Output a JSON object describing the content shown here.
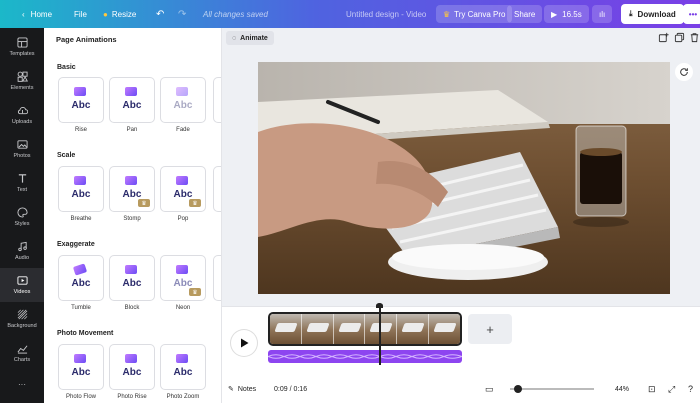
{
  "topbar": {
    "home": "Home",
    "file": "File",
    "resize": "Resize",
    "saved_status": "All changes saved",
    "doc_title": "Untitled design - Video",
    "try_pro": "Try Canva Pro",
    "share": "Share",
    "duration": "16.5s",
    "download": "Download",
    "more": "•••"
  },
  "rail": [
    {
      "label": "Templates",
      "icon": "templates-icon"
    },
    {
      "label": "Elements",
      "icon": "elements-icon"
    },
    {
      "label": "Uploads",
      "icon": "uploads-icon"
    },
    {
      "label": "Photos",
      "icon": "photos-icon"
    },
    {
      "label": "Text",
      "icon": "text-icon"
    },
    {
      "label": "Styles",
      "icon": "styles-icon"
    },
    {
      "label": "Audio",
      "icon": "audio-icon"
    },
    {
      "label": "Videos",
      "icon": "videos-icon"
    },
    {
      "label": "Background",
      "icon": "background-icon"
    },
    {
      "label": "Charts",
      "icon": "charts-icon"
    }
  ],
  "panel": {
    "title": "Page Animations",
    "tile_text": "Abc",
    "sections": [
      {
        "name": "Basic",
        "items": [
          {
            "label": "Rise",
            "pro": false
          },
          {
            "label": "Pan",
            "pro": false
          },
          {
            "label": "Fade",
            "pro": false
          }
        ]
      },
      {
        "name": "Scale",
        "items": [
          {
            "label": "Breathe",
            "pro": false
          },
          {
            "label": "Stomp",
            "pro": true
          },
          {
            "label": "Pop",
            "pro": true
          }
        ]
      },
      {
        "name": "Exaggerate",
        "items": [
          {
            "label": "Tumble",
            "pro": false
          },
          {
            "label": "Block",
            "pro": false
          },
          {
            "label": "Neon",
            "pro": true
          }
        ]
      },
      {
        "name": "Photo Movement",
        "items": [
          {
            "label": "Photo Flow",
            "pro": false
          },
          {
            "label": "Photo Rise",
            "pro": false
          },
          {
            "label": "Photo Zoom",
            "pro": false
          }
        ]
      }
    ]
  },
  "canvas": {
    "animate": "Animate"
  },
  "bottombar": {
    "notes": "Notes",
    "time": "0:09 / 0:16",
    "zoom": "44%"
  },
  "colors": {
    "accent": "#8d45f0",
    "rail_bg": "#18191b"
  }
}
